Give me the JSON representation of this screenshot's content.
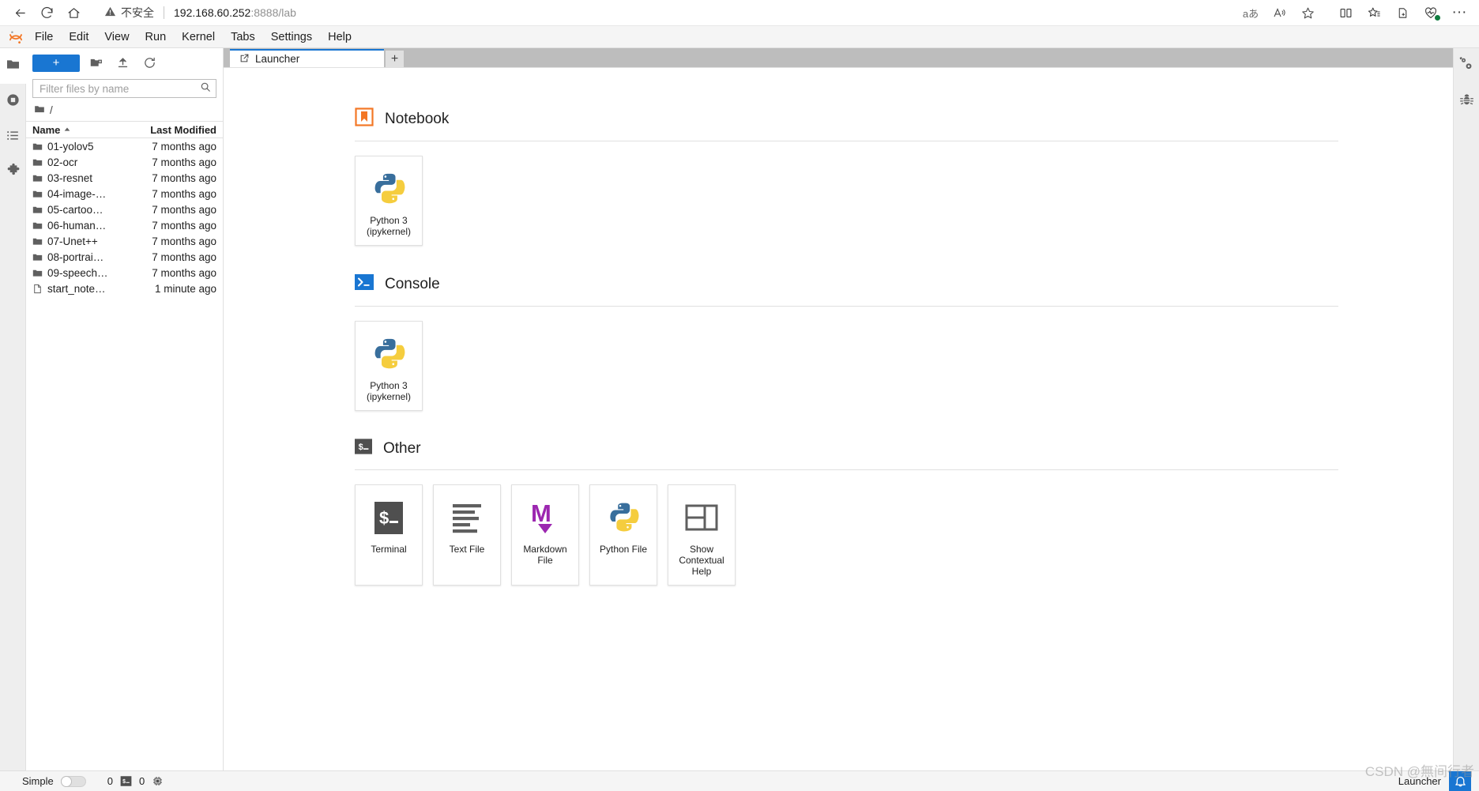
{
  "browser": {
    "nav": {
      "back_icon": "arrow-left-icon",
      "reload_icon": "reload-icon",
      "home_icon": "home-icon"
    },
    "omnibox": {
      "warning_icon": "warning-triangle-icon",
      "security_label": "不安全",
      "url_host": "192.168.60.252",
      "url_rest": ":8888/lab"
    },
    "toolbar_icons": [
      {
        "name": "translate-icon",
        "glyph": "aあ"
      },
      {
        "name": "read-aloud-icon",
        "glyph": "A"
      },
      {
        "name": "favorites-star-icon",
        "glyph": "☆"
      },
      {
        "name": "split-screen-icon",
        "glyph": "▯"
      },
      {
        "name": "collections-icon",
        "glyph": "☆"
      },
      {
        "name": "add-to-collection-icon",
        "glyph": "⊞"
      },
      {
        "name": "browser-essentials-icon",
        "glyph": "♡"
      },
      {
        "name": "settings-more-icon",
        "glyph": "…"
      }
    ]
  },
  "menubar": {
    "logo": "jupyter-logo",
    "items": [
      {
        "label": "File"
      },
      {
        "label": "Edit"
      },
      {
        "label": "View"
      },
      {
        "label": "Run"
      },
      {
        "label": "Kernel"
      },
      {
        "label": "Tabs"
      },
      {
        "label": "Settings"
      },
      {
        "label": "Help"
      }
    ]
  },
  "activitybar": {
    "items": [
      {
        "name": "file-browser-icon",
        "active": true
      },
      {
        "name": "running-terminals-icon",
        "active": false
      },
      {
        "name": "table-of-contents-icon",
        "active": false
      },
      {
        "name": "extension-manager-icon",
        "active": false
      }
    ]
  },
  "rightbar": {
    "items": [
      {
        "name": "property-inspector-icon"
      },
      {
        "name": "debugger-icon"
      }
    ]
  },
  "filebrowser": {
    "toolbar": {
      "new_launcher_label": "+",
      "new_folder_icon": "new-folder-icon",
      "upload_icon": "upload-icon",
      "refresh_icon": "refresh-icon"
    },
    "filter": {
      "placeholder": "Filter files by name",
      "value": "",
      "search_icon": "search-icon"
    },
    "breadcrumb": {
      "folder_icon": "folder-icon",
      "path": "/"
    },
    "columns": {
      "name": "Name",
      "sort_icon": "sort-ascending-icon",
      "last_modified": "Last Modified"
    },
    "rows": [
      {
        "icon": "folder-icon",
        "name": "01-yolov5",
        "modified": "7 months ago"
      },
      {
        "icon": "folder-icon",
        "name": "02-ocr",
        "modified": "7 months ago"
      },
      {
        "icon": "folder-icon",
        "name": "03-resnet",
        "modified": "7 months ago"
      },
      {
        "icon": "folder-icon",
        "name": "04-image-…",
        "modified": "7 months ago"
      },
      {
        "icon": "folder-icon",
        "name": "05-cartoo…",
        "modified": "7 months ago"
      },
      {
        "icon": "folder-icon",
        "name": "06-human…",
        "modified": "7 months ago"
      },
      {
        "icon": "folder-icon",
        "name": "07-Unet++",
        "modified": "7 months ago"
      },
      {
        "icon": "folder-icon",
        "name": "08-portrai…",
        "modified": "7 months ago"
      },
      {
        "icon": "folder-icon",
        "name": "09-speech…",
        "modified": "7 months ago"
      },
      {
        "icon": "file-icon",
        "name": "start_note…",
        "modified": "1 minute ago"
      }
    ]
  },
  "dock": {
    "tab": {
      "icon": "launcher-icon",
      "label": "Launcher"
    },
    "add_tab_label": "+"
  },
  "launcher": {
    "sections": [
      {
        "id": "notebook",
        "icon": "notebook-bookmark-icon",
        "title": "Notebook",
        "cards": [
          {
            "icon": "python-logo-icon",
            "label": "Python 3\n(ipykernel)"
          }
        ]
      },
      {
        "id": "console",
        "icon": "console-prompt-icon",
        "title": "Console",
        "cards": [
          {
            "icon": "python-logo-icon",
            "label": "Python 3\n(ipykernel)"
          }
        ]
      },
      {
        "id": "other",
        "icon": "terminal-dollar-icon",
        "title": "Other",
        "cards": [
          {
            "icon": "terminal-dollar-icon",
            "label": "Terminal"
          },
          {
            "icon": "text-file-icon",
            "label": "Text File"
          },
          {
            "icon": "markdown-file-icon",
            "label": "Markdown File"
          },
          {
            "icon": "python-file-icon",
            "label": "Python File"
          },
          {
            "icon": "contextual-help-icon",
            "label": "Show Contextual Help"
          }
        ]
      }
    ]
  },
  "statusbar": {
    "simple_label": "Simple",
    "simple_enabled": false,
    "kernel_count": "0",
    "terminal_icon": "terminal-dollar-icon",
    "terminal_count": "0",
    "kernel_icon": "cpu-chip-icon",
    "active_doc": "Launcher",
    "notification_icon": "bell-icon",
    "watermark": "CSDN @無间行者"
  },
  "colors": {
    "accent_blue": "#1976d2",
    "jupyter_orange": "#f37726",
    "markdown_purple": "#9c27b0",
    "python_blue": "#386e9c",
    "python_yellow": "#f5cd3e",
    "terminal_dark": "#4f4f4f",
    "tabbar_gray": "#bdbdbd"
  }
}
